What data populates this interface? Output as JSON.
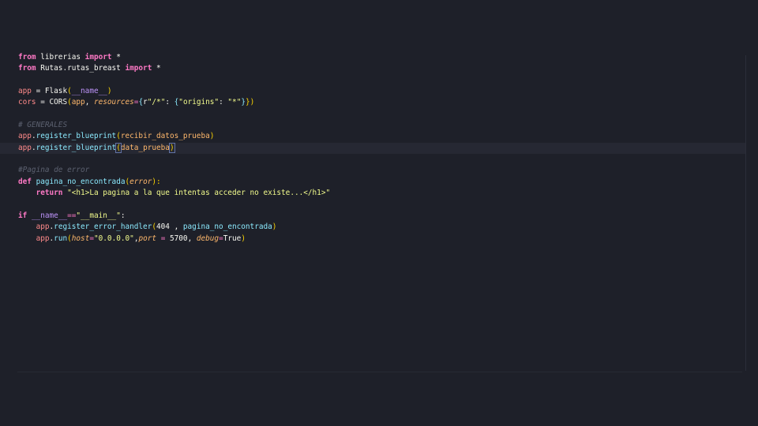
{
  "editor": {
    "lines": [
      [
        {
          "t": "from",
          "c": "kw"
        },
        {
          "t": " librerias ",
          "c": "plain"
        },
        {
          "t": "import",
          "c": "kw"
        },
        {
          "t": " *",
          "c": "plain"
        }
      ],
      [
        {
          "t": "from",
          "c": "kw"
        },
        {
          "t": " Rutas.rutas_breast ",
          "c": "plain"
        },
        {
          "t": "import",
          "c": "kw"
        },
        {
          "t": " *",
          "c": "plain"
        }
      ],
      [],
      [
        {
          "t": "app",
          "c": "ident"
        },
        {
          "t": " = Flask",
          "c": "plain"
        },
        {
          "t": "(",
          "c": "paren"
        },
        {
          "t": "__name__",
          "c": "dunder"
        },
        {
          "t": ")",
          "c": "paren"
        }
      ],
      [
        {
          "t": "cors",
          "c": "ident"
        },
        {
          "t": " = CORS",
          "c": "plain"
        },
        {
          "t": "(",
          "c": "paren"
        },
        {
          "t": "app",
          "c": "var"
        },
        {
          "t": ", ",
          "c": "plain"
        },
        {
          "t": "resources",
          "c": "param"
        },
        {
          "t": "=",
          "c": "op"
        },
        {
          "t": "{",
          "c": "brace"
        },
        {
          "t": "r",
          "c": "plain"
        },
        {
          "t": "\"/*\"",
          "c": "str"
        },
        {
          "t": ": ",
          "c": "plain"
        },
        {
          "t": "{",
          "c": "brace"
        },
        {
          "t": "\"origins\"",
          "c": "str"
        },
        {
          "t": ": ",
          "c": "plain"
        },
        {
          "t": "\"*\"",
          "c": "str"
        },
        {
          "t": "}",
          "c": "brace"
        },
        {
          "t": "})",
          "c": "paren"
        }
      ],
      [],
      [
        {
          "t": "# GENERALES",
          "c": "comment"
        }
      ],
      [
        {
          "t": "app",
          "c": "ident"
        },
        {
          "t": ".",
          "c": "plain"
        },
        {
          "t": "register_blueprint",
          "c": "fn"
        },
        {
          "t": "(",
          "c": "paren"
        },
        {
          "t": "recibir_datos_prueba",
          "c": "var"
        },
        {
          "t": ")",
          "c": "paren"
        }
      ],
      [
        {
          "t": "app",
          "c": "ident"
        },
        {
          "t": ".",
          "c": "plain"
        },
        {
          "t": "register_blueprint",
          "c": "fn"
        },
        {
          "t": "(",
          "c": "paren bracket-hl"
        },
        {
          "t": "data_prueba",
          "c": "var"
        },
        {
          "t": ")",
          "c": "paren bracket-hl"
        }
      ],
      [],
      [
        {
          "t": "#Pagina de error",
          "c": "comment"
        }
      ],
      [
        {
          "t": "def",
          "c": "kw"
        },
        {
          "t": " ",
          "c": "plain"
        },
        {
          "t": "pagina_no_encontrada",
          "c": "fn"
        },
        {
          "t": "(",
          "c": "paren"
        },
        {
          "t": "error",
          "c": "param"
        },
        {
          "t": "):",
          "c": "paren"
        }
      ],
      [
        {
          "t": "    ",
          "c": "plain"
        },
        {
          "t": "return",
          "c": "kw"
        },
        {
          "t": " ",
          "c": "plain"
        },
        {
          "t": "\"<h1>La pagina a la que intentas acceder no existe...</h1>\"",
          "c": "str"
        }
      ],
      [],
      [
        {
          "t": "if",
          "c": "kw"
        },
        {
          "t": " ",
          "c": "plain"
        },
        {
          "t": "__name__",
          "c": "dunder"
        },
        {
          "t": "==",
          "c": "op"
        },
        {
          "t": "\"__main__\"",
          "c": "str"
        },
        {
          "t": ":",
          "c": "plain"
        }
      ],
      [
        {
          "t": "    ",
          "c": "plain"
        },
        {
          "t": "app",
          "c": "ident"
        },
        {
          "t": ".",
          "c": "plain"
        },
        {
          "t": "register_error_handler",
          "c": "fn"
        },
        {
          "t": "(",
          "c": "paren"
        },
        {
          "t": "404",
          "c": "num"
        },
        {
          "t": " , ",
          "c": "plain"
        },
        {
          "t": "pagina_no_encontrada",
          "c": "fn"
        },
        {
          "t": ")",
          "c": "paren"
        }
      ],
      [
        {
          "t": "    ",
          "c": "plain"
        },
        {
          "t": "app",
          "c": "ident"
        },
        {
          "t": ".",
          "c": "plain"
        },
        {
          "t": "run",
          "c": "fn"
        },
        {
          "t": "(",
          "c": "paren"
        },
        {
          "t": "host",
          "c": "param"
        },
        {
          "t": "=",
          "c": "op"
        },
        {
          "t": "\"0.0.0.0\"",
          "c": "str"
        },
        {
          "t": ",",
          "c": "plain"
        },
        {
          "t": "port",
          "c": "param"
        },
        {
          "t": " = ",
          "c": "op"
        },
        {
          "t": "5700",
          "c": "num"
        },
        {
          "t": ", ",
          "c": "plain"
        },
        {
          "t": "debug",
          "c": "param"
        },
        {
          "t": "=",
          "c": "op"
        },
        {
          "t": "True",
          "c": "plain"
        },
        {
          "t": ")",
          "c": "paren"
        }
      ]
    ],
    "current_line_index": 8
  },
  "colors": {
    "background": "#1e2029",
    "current_line": "#262833",
    "keyword": "#ff79c6",
    "function": "#8be9fd",
    "string": "#f1fa8c",
    "comment": "#5c6170",
    "parameter": "#ffb86c",
    "identifier": "#ff8a8a",
    "dunder": "#bd93f9"
  }
}
